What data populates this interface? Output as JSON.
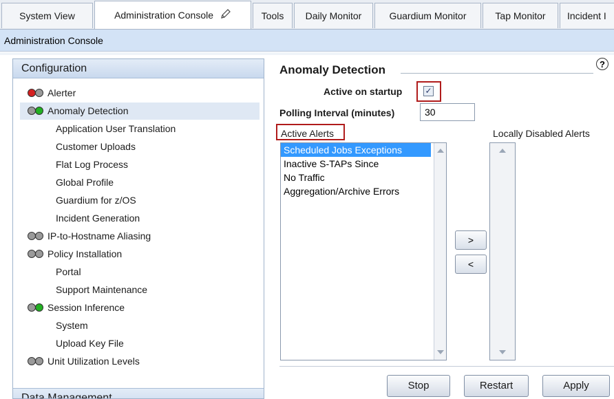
{
  "tabs": [
    {
      "label": "System View"
    },
    {
      "label": "Administration Console"
    },
    {
      "label": "Tools"
    },
    {
      "label": "Daily Monitor"
    },
    {
      "label": "Guardium Monitor"
    },
    {
      "label": "Tap Monitor"
    },
    {
      "label": "Incident I"
    }
  ],
  "subheader": {
    "title": "Administration Console"
  },
  "sidebar": {
    "header": "Configuration",
    "items": [
      {
        "label": "Alerter",
        "status": [
          "red",
          "gray"
        ]
      },
      {
        "label": "Anomaly Detection",
        "status": [
          "gray",
          "green"
        ],
        "selected": true
      },
      {
        "label": "Application User Translation"
      },
      {
        "label": "Customer Uploads"
      },
      {
        "label": "Flat Log Process"
      },
      {
        "label": "Global Profile"
      },
      {
        "label": "Guardium for z/OS"
      },
      {
        "label": "Incident Generation"
      },
      {
        "label": "IP-to-Hostname Aliasing",
        "status": [
          "gray",
          "gray"
        ]
      },
      {
        "label": "Policy Installation",
        "status": [
          "gray",
          "gray"
        ]
      },
      {
        "label": "Portal"
      },
      {
        "label": "Support Maintenance"
      },
      {
        "label": "Session Inference",
        "status": [
          "gray",
          "green"
        ]
      },
      {
        "label": "System"
      },
      {
        "label": "Upload Key File"
      },
      {
        "label": "Unit Utilization Levels",
        "status": [
          "gray",
          "gray"
        ]
      }
    ],
    "footer": "Data Management"
  },
  "main": {
    "title": "Anomaly Detection",
    "help": "?",
    "active_on_startup_label": "Active on startup",
    "active_on_startup_checked": true,
    "polling_label": "Polling Interval (minutes)",
    "polling_value": "30",
    "active_alerts_label": "Active Alerts",
    "active_alerts": [
      "Scheduled Jobs Exceptions",
      "Inactive S-TAPs Since",
      "No Traffic",
      "Aggregation/Archive Errors"
    ],
    "disabled_alerts_label": "Locally Disabled Alerts",
    "move_right_label": ">",
    "move_left_label": "<",
    "buttons": {
      "stop": "Stop",
      "restart": "Restart",
      "apply": "Apply"
    }
  },
  "colors": {
    "red": "#d42020",
    "green": "#22b022",
    "gray": "#9a9a9a",
    "selection": "#3399ff",
    "highlight_box": "#b01b1b"
  }
}
